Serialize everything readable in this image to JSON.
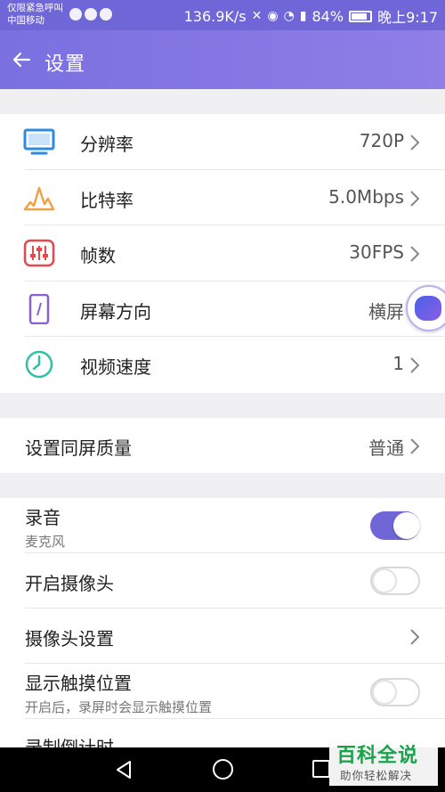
{
  "status_bar": {
    "carrier_line1": "仅限紧急呼叫",
    "carrier_line2": "中国移动",
    "net_speed": "136.9K/s",
    "battery": "84%",
    "time": "晚上9:17"
  },
  "app_bar": {
    "title": "设置"
  },
  "video_settings": [
    {
      "label": "分辨率",
      "value": "720P",
      "icon": "monitor-icon",
      "color": "#2d8be0"
    },
    {
      "label": "比特率",
      "value": "5.0Mbps",
      "icon": "waveform-icon",
      "color": "#f0a24a"
    },
    {
      "label": "帧数",
      "value": "30FPS",
      "icon": "sliders-icon",
      "color": "#e5484d"
    },
    {
      "label": "屏幕方向",
      "value": "横屏",
      "icon": "phone-orientation-icon",
      "color": "#8b5fd6"
    },
    {
      "label": "视频速度",
      "value": "1",
      "icon": "clock-icon",
      "color": "#2fc1a8"
    }
  ],
  "mirror_quality": {
    "label": "设置同屏质量",
    "value": "普通"
  },
  "record_options": {
    "audio": {
      "label": "录音",
      "sub": "麦克风",
      "on": true
    },
    "camera": {
      "label": "开启摄像头",
      "on": false
    },
    "camera_settings": {
      "label": "摄像头设置"
    },
    "touch": {
      "label": "显示触摸位置",
      "sub": "开启后，录屏时会显示触摸位置",
      "on": false
    },
    "countdown": {
      "label": "录制倒计时"
    }
  },
  "watermark": {
    "title": "百科全说",
    "subtitle": "助你轻松解决"
  },
  "colors": {
    "accent": "#6f66d8",
    "background": "#f0f0f2"
  }
}
